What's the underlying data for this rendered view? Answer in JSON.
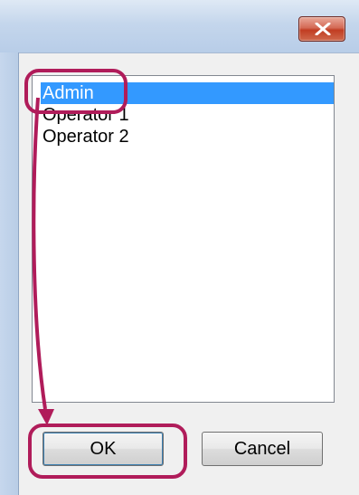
{
  "list": {
    "items": [
      "Admin",
      "Operator 1",
      "Operator 2"
    ],
    "selected_index": 0
  },
  "buttons": {
    "ok_label": "OK",
    "cancel_label": "Cancel"
  },
  "icons": {
    "close": "close-icon"
  },
  "colors": {
    "selection": "#3399ff",
    "annotation": "#b01c5a",
    "close_button": "#c13d22"
  }
}
